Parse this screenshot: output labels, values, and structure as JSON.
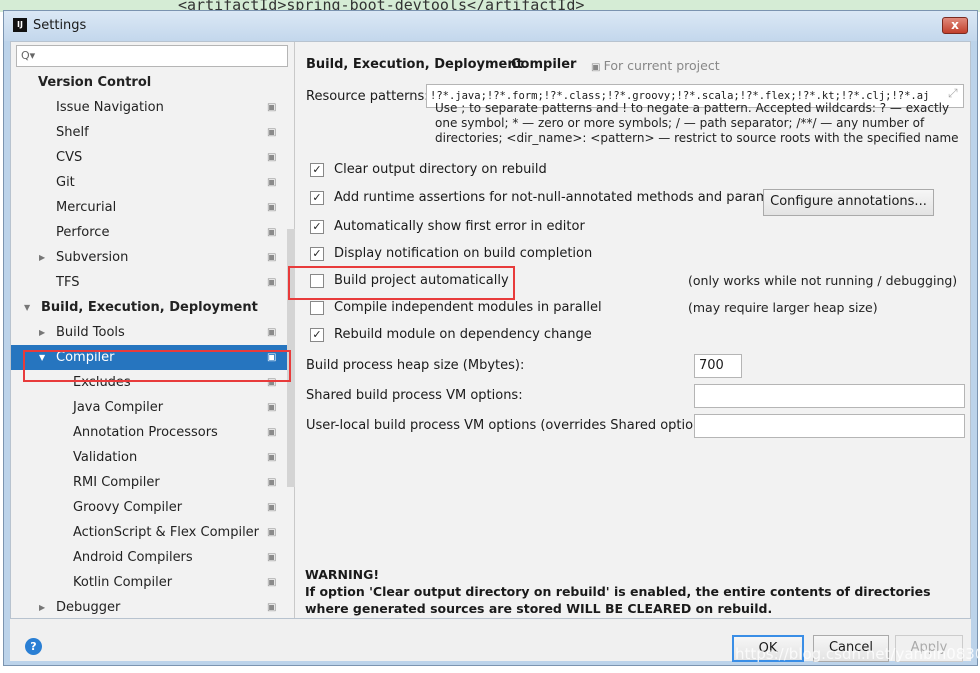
{
  "background_code": "<artifactId>spring-boot-devtools</artifactId>",
  "window": {
    "title": "Settings",
    "logo": "IJ",
    "close": "x"
  },
  "sidebar": {
    "search_placeholder": "Q▾",
    "items": [
      {
        "label": "Version Control",
        "level": 0,
        "bold": true
      },
      {
        "label": "Issue Navigation",
        "level": 1
      },
      {
        "label": "Shelf",
        "level": 1
      },
      {
        "label": "CVS",
        "level": 1
      },
      {
        "label": "Git",
        "level": 1
      },
      {
        "label": "Mercurial",
        "level": 1
      },
      {
        "label": "Perforce",
        "level": 1
      },
      {
        "label": "Subversion",
        "level": 1,
        "arrow": "›"
      },
      {
        "label": "TFS",
        "level": 1
      },
      {
        "label": "Build, Execution, Deployment",
        "level": 0,
        "bold": true,
        "arrow": "⌄"
      },
      {
        "label": "Build Tools",
        "level": 1,
        "arrow": "›"
      },
      {
        "label": "Compiler",
        "level": 1,
        "arrow": "⌄",
        "selected": true
      },
      {
        "label": "Excludes",
        "level": 2
      },
      {
        "label": "Java Compiler",
        "level": 2
      },
      {
        "label": "Annotation Processors",
        "level": 2
      },
      {
        "label": "Validation",
        "level": 2
      },
      {
        "label": "RMI Compiler",
        "level": 2
      },
      {
        "label": "Groovy Compiler",
        "level": 2
      },
      {
        "label": "ActionScript & Flex Compiler",
        "level": 2
      },
      {
        "label": "Android Compilers",
        "level": 2
      },
      {
        "label": "Kotlin Compiler",
        "level": 2
      },
      {
        "label": "Debugger",
        "level": 1,
        "arrow": "›"
      }
    ]
  },
  "main": {
    "breadcrumb": [
      "Build, Execution, Deployment",
      "Compiler"
    ],
    "breadcrumb_sep": "›",
    "for_current_project": "For current project",
    "resource_patterns_label": "Resource patterns:",
    "resource_patterns_value": "!?*.java;!?*.form;!?*.class;!?*.groovy;!?*.scala;!?*.flex;!?*.kt;!?*.clj;!?*.aj",
    "hint": "Use ; to separate patterns and ! to negate a pattern. Accepted wildcards: ? — exactly one symbol; * — zero or more symbols; / — path separator; /**/ — any number of directories; <dir_name>: <pattern> — restrict to source roots with the specified name",
    "options": [
      {
        "label": "Clear output directory on rebuild",
        "checked": true
      },
      {
        "label": "Add runtime assertions for not-null-annotated methods and parameters",
        "checked": true
      },
      {
        "label": "Automatically show first error in editor",
        "checked": true
      },
      {
        "label": "Display notification on build completion",
        "checked": true
      },
      {
        "label": "Build project automatically",
        "checked": false,
        "note": "(only works while not running / debugging)"
      },
      {
        "label": "Compile independent modules in parallel",
        "checked": false,
        "note": "(may require larger heap size)"
      },
      {
        "label": "Rebuild module on dependency change",
        "checked": true
      }
    ],
    "configure_annotations": "Configure annotations...",
    "heap_label": "Build process heap size (Mbytes):",
    "heap_value": "700",
    "shared_vm_label": "Shared build process VM options:",
    "shared_vm_value": "",
    "user_vm_label": "User-local build process VM options (overrides Shared options):",
    "user_vm_value": "",
    "warning_title": "WARNING!",
    "warning_text": "If option 'Clear output directory on rebuild' is enabled, the entire contents of directories where generated sources are stored WILL BE CLEARED on rebuild."
  },
  "footer": {
    "help": "?",
    "ok": "OK",
    "cancel": "Cancel",
    "apply": "Apply"
  },
  "watermark": "https://blog.csdn.net/yanbin0830",
  "colors": {
    "selection": "#2675bf",
    "highlight_box": "#e83b3b"
  }
}
